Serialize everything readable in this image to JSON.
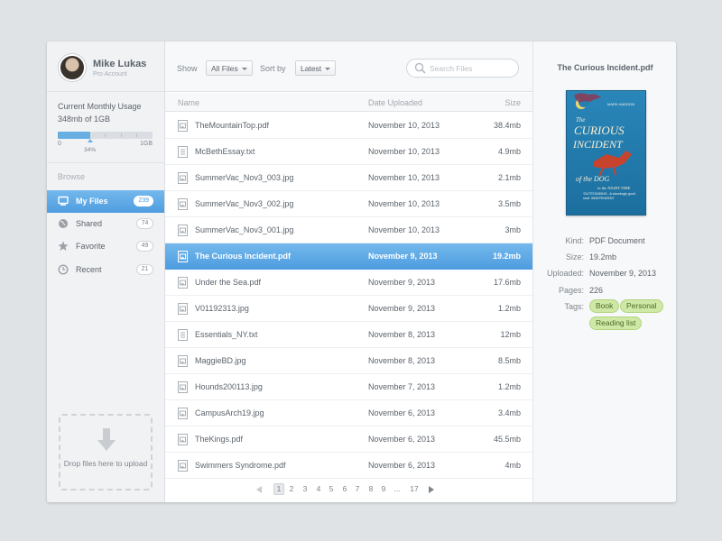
{
  "profile": {
    "name": "Mike Lukas",
    "subtitle": "Pro Account"
  },
  "usage": {
    "title": "Current Monthly Usage",
    "amount": "348mb of 1GB",
    "min_label": "0",
    "max_label": "1GB",
    "percent_label": "34%",
    "fill_fraction": 0.34
  },
  "sidebar": {
    "browse_label": "Browse",
    "items": [
      {
        "label": "My Files",
        "count": "239",
        "icon": "computer-icon",
        "active": true
      },
      {
        "label": "Shared",
        "count": "74",
        "icon": "globe-icon",
        "active": false
      },
      {
        "label": "Favorite",
        "count": "49",
        "icon": "star-icon",
        "active": false
      },
      {
        "label": "Recent",
        "count": "21",
        "icon": "clock-icon",
        "active": false
      }
    ],
    "dropzone_text": "Drop files here to upload"
  },
  "toolbar": {
    "show_label": "Show",
    "show_value": "All Files",
    "sort_label": "Sort by",
    "sort_value": "Latest",
    "search_placeholder": "Search Files"
  },
  "table": {
    "columns": [
      "Name",
      "Date Uploaded",
      "Size"
    ],
    "rows": [
      {
        "name": "TheMountainTop.pdf",
        "date": "November 10, 2013",
        "size": "38.4mb",
        "type": "image"
      },
      {
        "name": "McBethEssay.txt",
        "date": "November 10, 2013",
        "size": "4.9mb",
        "type": "text"
      },
      {
        "name": "SummerVac_Nov3_003.jpg",
        "date": "November 10, 2013",
        "size": "2.1mb",
        "type": "image"
      },
      {
        "name": "SummerVac_Nov3_002.jpg",
        "date": "November 10, 2013",
        "size": "3.5mb",
        "type": "image"
      },
      {
        "name": "SummerVac_Nov3_001.jpg",
        "date": "November 10, 2013",
        "size": "3mb",
        "type": "image"
      },
      {
        "name": "The Curious Incident.pdf",
        "date": "November 9, 2013",
        "size": "19.2mb",
        "type": "image",
        "selected": true
      },
      {
        "name": "Under the Sea.pdf",
        "date": "November 9, 2013",
        "size": "17.6mb",
        "type": "image"
      },
      {
        "name": "V01192313.jpg",
        "date": "November 9, 2013",
        "size": "1.2mb",
        "type": "image"
      },
      {
        "name": "Essentials_NY.txt",
        "date": "November 8, 2013",
        "size": "12mb",
        "type": "text"
      },
      {
        "name": "MaggieBD.jpg",
        "date": "November 8, 2013",
        "size": "8.5mb",
        "type": "image"
      },
      {
        "name": "Hounds200113.jpg",
        "date": "November 7, 2013",
        "size": "1.2mb",
        "type": "image"
      },
      {
        "name": "CampusArch19.jpg",
        "date": "November 6, 2013",
        "size": "3.4mb",
        "type": "image"
      },
      {
        "name": "TheKings.pdf",
        "date": "November 6, 2013",
        "size": "45.5mb",
        "type": "image"
      },
      {
        "name": "Swimmers Syndrome.pdf",
        "date": "November 6, 2013",
        "size": "4mb",
        "type": "image"
      }
    ]
  },
  "pagination": {
    "current": "1",
    "pages": [
      "1",
      "2",
      "3",
      "4",
      "5",
      "6",
      "7",
      "8",
      "9",
      "...",
      "17"
    ]
  },
  "detail": {
    "title": "The Curious Incident.pdf",
    "cover": {
      "author": "MARK HADDON",
      "title_line1": "The",
      "title_line2": "CURIOUS",
      "title_line3": "INCIDENT",
      "subtitle_line1": "of the DOG",
      "subtitle_line2": "in the NIGHT-TIME",
      "quote": "'OUTSTANDING...A stunningly good read' INDEPENDENT"
    },
    "meta": [
      {
        "key": "Kind:",
        "value": "PDF Document"
      },
      {
        "key": "Size:",
        "value": "19.2mb"
      },
      {
        "key": "Uploaded:",
        "value": "November 9, 2013"
      },
      {
        "key": "Pages:",
        "value": "226"
      }
    ],
    "tags_label": "Tags:",
    "tags": [
      "Book",
      "Personal",
      "Reading list"
    ]
  },
  "colors": {
    "accent": "#4e9de0",
    "accent_light": "#74b8ec",
    "tag_bg": "#cfe8a6",
    "tag_text": "#4c6a2a"
  }
}
